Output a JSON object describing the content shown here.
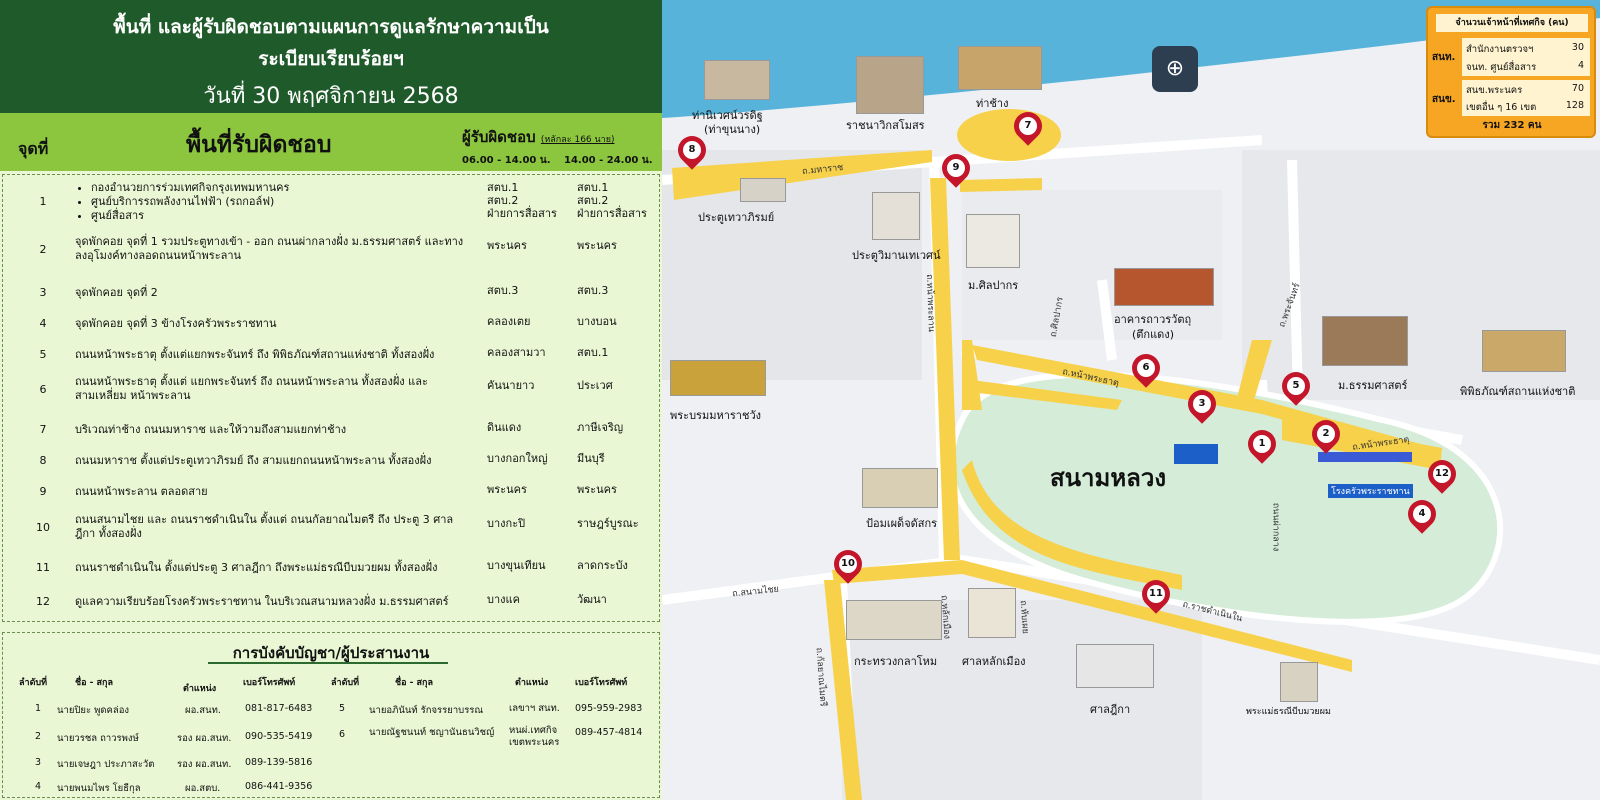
{
  "header": {
    "title_line1": "พื้นที่ และผู้รับผิดชอบตามแผนการดูแลรักษาความเป็น",
    "title_line2": "ระเบียบเรียบร้อยฯ",
    "date": "วันที่ 30 พฤศจิกายน 2568"
  },
  "table": {
    "col_no": "จุดที่",
    "col_area": "พื้นที่รับผิดชอบ",
    "col_resp": "ผู้รับผิดชอบ",
    "col_resp_note": "(หลักละ 166 นาย)",
    "shift_day": "06.00 - 14.00 น.",
    "shift_night": "14.00 - 24.00 น.",
    "rows": [
      {
        "no": "1",
        "area": [
          "กองอำนวยการร่วมเทศกิจกรุงเทพมหานคร",
          "ศูนย์บริการรถพลังงานไฟฟ้า (รถกอล์ฟ)",
          "ศูนย์สื่อสาร"
        ],
        "day": [
          "สตบ.1",
          "สตบ.2",
          "ฝ่ายการสื่อสาร"
        ],
        "night": [
          "สตบ.1",
          "สตบ.2",
          "ฝ่ายการสื่อสาร"
        ]
      },
      {
        "no": "2",
        "area": "จุดพักคอย จุดที่ 1 รวมประตูทางเข้า - ออก ถนนผ่ากลางฝั่ง ม.ธรรมศาสตร์ และทางลงอุโมงค์ทางลอดถนนหน้าพระลาน",
        "day": "พระนคร",
        "night": "พระนคร"
      },
      {
        "no": "3",
        "area": "จุดพักคอย จุดที่ 2",
        "day": "สตบ.3",
        "night": "สตบ.3"
      },
      {
        "no": "4",
        "area": "จุดพักคอย จุดที่ 3 ข้างโรงครัวพระราชทาน",
        "day": "คลองเตย",
        "night": "บางบอน"
      },
      {
        "no": "5",
        "area": "ถนนหน้าพระธาตุ ตั้งแต่แยกพระจันทร์ ถึง พิพิธภัณฑ์สถานแห่งชาติ ทั้งสองฝั่ง",
        "day": "คลองสามวา",
        "night": "สตบ.1"
      },
      {
        "no": "6",
        "area": "ถนนหน้าพระธาตุ ตั้งแต่ แยกพระจันทร์ ถึง ถนนหน้าพระลาน ทั้งสองฝั่ง และสามเหลี่ยม หน้าพระลาน",
        "day": "คันนายาว",
        "night": "ประเวศ"
      },
      {
        "no": "7",
        "area": "บริเวณท่าช้าง ถนนมหาราช และให้วามถึงสามแยกท่าช้าง",
        "day": "ดินแดง",
        "night": "ภาษีเจริญ"
      },
      {
        "no": "8",
        "area": "ถนนมหาราช ตั้งแต่ประตูเทวาภิรมย์ ถึง สามแยกถนนหน้าพระลาน ทั้งสองฝั่ง",
        "day": "บางกอกใหญ่",
        "night": "มีนบุรี"
      },
      {
        "no": "9",
        "area": "ถนนหน้าพระลาน ตลอดสาย",
        "day": "พระนคร",
        "night": "พระนคร"
      },
      {
        "no": "10",
        "area": "ถนนสนามไชย และ ถนนราชดำเนินใน ตั้งแต่ ถนนกัลยาณไมตรี ถึง ประตู 3 ศาลฎีกา ทั้งสองฝั่ง",
        "day": "บางกะปิ",
        "night": "ราษฎร์บูรณะ"
      },
      {
        "no": "11",
        "area": "ถนนราชดำเนินใน ตั้งแต่ประตู 3 ศาลฎีกา ถึงพระแม่ธรณีบีบมวยผม ทั้งสองฝั่ง",
        "day": "บางขุนเทียน",
        "night": "ลาดกระบัง"
      },
      {
        "no": "12",
        "area": "ดูแลความเรียบร้อยโรงครัวพระราชทาน ในบริเวณสนามหลวงฝั่ง ม.ธรรมศาสตร์",
        "day": "บางแค",
        "night": "วัฒนา"
      }
    ]
  },
  "command": {
    "title": "การบังคับบัญชา/ผู้ประสานงาน",
    "headers": {
      "seq": "ลำดับที่",
      "name": "ชื่อ - สกุล",
      "position": "ตำแหน่ง",
      "phone": "เบอร์โทรศัพท์"
    },
    "left": [
      {
        "seq": "1",
        "name": "นายปิยะ  พูดคล่อง",
        "position": "ผอ.สนท.",
        "phone": "081-817-6483"
      },
      {
        "seq": "2",
        "name": "นายวรชล  ถาวรพงษ์",
        "position": "รอง ผอ.สนท.",
        "phone": "090-535-5419"
      },
      {
        "seq": "3",
        "name": "นายเจษฎา  ประภาสะวัต",
        "position": "รอง ผอ.สนท.",
        "phone": "089-139-5816"
      },
      {
        "seq": "4",
        "name": "นายพนมไพร  โยธีกุล",
        "position": "ผอ.สตบ.",
        "phone": "086-441-9356"
      }
    ],
    "right": [
      {
        "seq": "5",
        "name": "นายอภินันท์  รักจรรยาบรรณ",
        "position": "เลขาฯ สนท.",
        "phone": "095-959-2983"
      },
      {
        "seq": "6",
        "name": "นายณัฐชนนท์  ชญานันธนวิชญ์",
        "position": "หนผ่.เทศกิจ",
        "position2": "เขตพระนคร",
        "phone": "089-457-4814"
      }
    ]
  },
  "staff": {
    "title": "จำนวนเจ้าหน้าที่เทศกิจ (คน)",
    "group1": "สนท.",
    "g1_items": [
      {
        "label": "สำนักงานตรวจฯ",
        "value": "30"
      },
      {
        "label": "จนท. ศูนย์สื่อสาร",
        "value": "4"
      }
    ],
    "group2": "สนข.",
    "g2_items": [
      {
        "label": "สนข.พระนคร",
        "value": "70"
      },
      {
        "label": "เขตอื่น ๆ 16 เขต",
        "value": "128"
      }
    ],
    "total": "รวม  232  คน"
  },
  "map": {
    "field_label": "สนามหลวง",
    "places": {
      "p1": "ท่านิเวศน์วรดิฐ",
      "p1b": "(ท่าขุนนาง)",
      "p2": "ราชนาวิกสโมสร",
      "p3": "ท่าช้าง",
      "p4": "ประตูเทวาภิรมย์",
      "p5": "ประตูวิมานเทเวศน์",
      "p6": "ม.ศิลปากร",
      "p7": "อาคารถาวรวัตถุ",
      "p7b": "(ตึกแดง)",
      "p8": "ม.ธรรมศาสตร์",
      "p9": "พิพิธภัณฑ์สถานแห่งชาติ",
      "p10": "พระบรมมหาราชวัง",
      "p11": "ป้อมเผด็จดัสกร",
      "p12": "กระทรวงกลาโหม",
      "p13": "ศาลหลักเมือง",
      "p14": "ศาลฎีกา",
      "p15": "พระแม่ธรณีบีบมวยผม",
      "p16": "โรงครัวพระราชทาน"
    },
    "roads": {
      "r1": "ถ.มหาราช",
      "r2": "ถ.หน้าพระลาน",
      "r3": "ถ.หน้าพระธาตุ",
      "r4": "ถ.หน้าพระธาตุ",
      "r5": "ถ.พระจันทร์",
      "r6": "ถ.สนามไชย",
      "r7": "ถ.ราชดำเนินใน",
      "r8": "ถ.กัลยาณไมตรี",
      "r9": "ถ.หลักเมือง",
      "r10": "ถ.หับเผย",
      "r11": "ถ.ศิลปากร",
      "r12": "ถนนผ่ากลาง"
    },
    "pins": [
      "1",
      "2",
      "3",
      "4",
      "5",
      "6",
      "7",
      "8",
      "9",
      "10",
      "11",
      "12"
    ],
    "colors": {
      "zone": "#f7d14a",
      "pin": "#c4162a",
      "river": "#57b3d9",
      "field": "#d5ecd9"
    }
  }
}
